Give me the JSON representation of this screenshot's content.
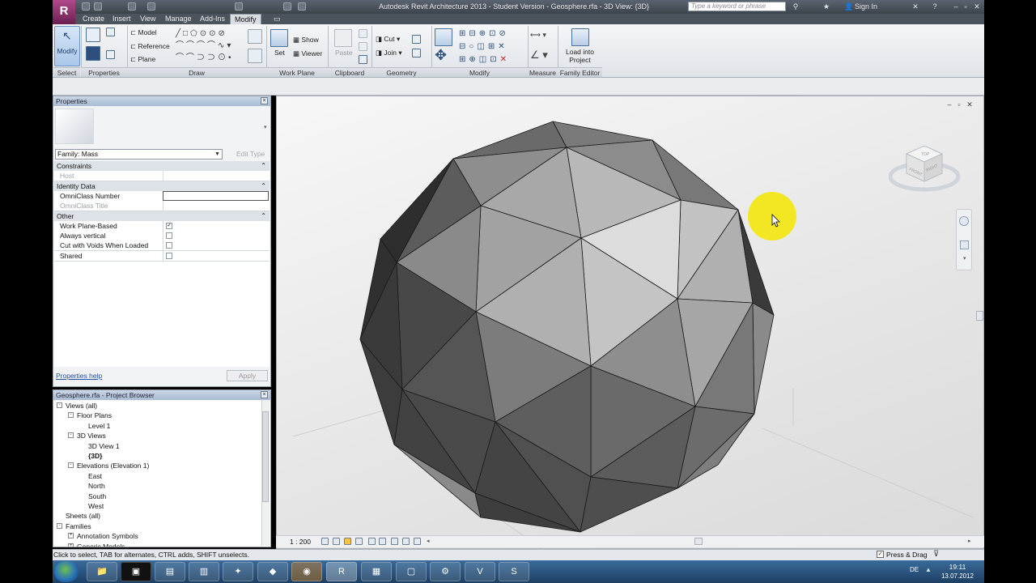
{
  "window": {
    "title": "Autodesk Revit Architecture 2013 - Student Version -    Geosphere.rfa - 3D View: {3D}",
    "search_placeholder": "Type a keyword or phrase",
    "signin": "Sign In"
  },
  "tabs": [
    "Create",
    "Insert",
    "View",
    "Manage",
    "Add-Ins",
    "Modify"
  ],
  "active_tab": "Modify",
  "ribbon": {
    "select": {
      "button": "Modify",
      "label": "Select"
    },
    "properties": {
      "label": "Properties"
    },
    "draw": {
      "model": "Model",
      "reference": "Reference",
      "plane": "Plane",
      "label": "Draw"
    },
    "work_plane": {
      "set": "Set",
      "show": "Show",
      "viewer": "Viewer",
      "label": "Work Plane"
    },
    "clipboard": {
      "paste": "Paste",
      "label": "Clipboard"
    },
    "geometry": {
      "cut": "Cut",
      "join": "Join",
      "label": "Geometry"
    },
    "modify": {
      "label": "Modify"
    },
    "measure": {
      "label": "Measure"
    },
    "family_editor": {
      "load_line1": "Load into",
      "load_line2": "Project",
      "label": "Family Editor"
    }
  },
  "properties_palette": {
    "title": "Properties",
    "family_select": "Family: Mass",
    "edit_type": "Edit Type",
    "groups": [
      {
        "name": "Constraints",
        "rows": [
          {
            "name": "Host",
            "disabled": true
          }
        ]
      },
      {
        "name": "Identity Data",
        "rows": [
          {
            "name": "OmniClass Number",
            "disabled": false
          },
          {
            "name": "OmniClass Title",
            "disabled": true
          }
        ]
      },
      {
        "name": "Other",
        "rows": [
          {
            "name": "Work Plane-Based",
            "checked": true
          },
          {
            "name": "Always vertical",
            "checked": false
          },
          {
            "name": "Cut with Voids When Loaded",
            "checked": false
          },
          {
            "name": "Shared",
            "checked": false
          }
        ]
      }
    ],
    "help_link": "Properties help",
    "apply": "Apply"
  },
  "project_browser": {
    "title": "Geosphere.rfa - Project Browser",
    "items": [
      {
        "label": "Views (all)",
        "level": 0,
        "toggle": "-"
      },
      {
        "label": "Floor Plans",
        "level": 1,
        "toggle": "-"
      },
      {
        "label": "Level 1",
        "level": 2
      },
      {
        "label": "3D Views",
        "level": 1,
        "toggle": "-"
      },
      {
        "label": "3D View 1",
        "level": 2
      },
      {
        "label": "{3D}",
        "level": 2,
        "bold": true
      },
      {
        "label": "Elevations (Elevation 1)",
        "level": 1,
        "toggle": "-"
      },
      {
        "label": "East",
        "level": 2
      },
      {
        "label": "North",
        "level": 2
      },
      {
        "label": "South",
        "level": 2
      },
      {
        "label": "West",
        "level": 2
      },
      {
        "label": "Sheets (all)",
        "level": 0
      },
      {
        "label": "Families",
        "level": 0,
        "toggle": "-"
      },
      {
        "label": "Annotation Symbols",
        "level": 1,
        "toggle": "+"
      },
      {
        "label": "Generic Models",
        "level": 1,
        "toggle": "+"
      }
    ]
  },
  "viewcube": {
    "top": "TOP",
    "front": "FRONT",
    "right": "RIGHT"
  },
  "view_control": {
    "scale": "1 : 200"
  },
  "status": {
    "text": "Click to select, TAB for alternates, CTRL adds, SHIFT unselects.",
    "press_drag": "Press & Drag"
  },
  "taskbar": {
    "lang": "DE",
    "time": "19:11",
    "date": "13.07.2012"
  },
  "colors": {
    "accent": "#6f94c2",
    "highlight": "#f5e600",
    "app_brand": "#8b2c6b"
  }
}
